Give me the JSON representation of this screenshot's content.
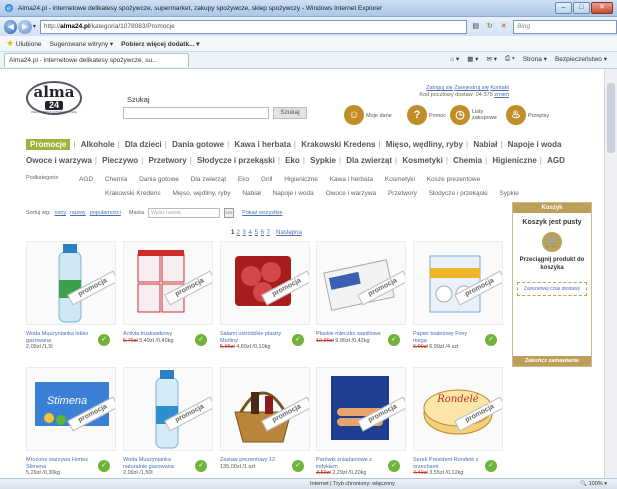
{
  "window": {
    "title": "Alma24.pl - internetowe delikatesy spożywcze, supermarket, zakupy spożywcze, sklep spożywczy - Windows Internet Explorer"
  },
  "addressbar": {
    "url_prefix": "http://",
    "url_domain": "alma24.pl",
    "url_path": "/kategoria/1078083/Promocje",
    "search_placeholder": "Bing"
  },
  "favorites": {
    "label": "Ulubione",
    "items": [
      "Sugerowane witryny ▾",
      "Pobierz więcej dodatk... ▾"
    ]
  },
  "tab": {
    "title": "Alma24.pl - internetowe delikatesy spożywcze, su...",
    "tools": [
      "Strona ▾",
      "Bezpieczeństwo ▾"
    ]
  },
  "header": {
    "logo_brand": "alma",
    "logo_number": "24",
    "logo_tagline": "DELIKATESY INTERNETOWE",
    "search_label": "Szukaj",
    "search_button": "Szukaj",
    "links_line1": [
      "Zaloguj się",
      "Zarejestruj się",
      "Kontakt"
    ],
    "postal_text": "Kod pocztowy dostaw: 04-375",
    "postal_link": "zmień",
    "icons": [
      {
        "label": "Moje dane",
        "icon": "user-icon"
      },
      {
        "label": "Pomoc",
        "icon": "help-icon"
      },
      {
        "label": "Listy zakupowe",
        "icon": "clock-icon"
      },
      {
        "label": "Przepisy",
        "icon": "pot-icon"
      }
    ]
  },
  "nav": {
    "row1": [
      "Promocje",
      "Alkohole",
      "Dla dzieci",
      "Dania gotowe",
      "Kawa i herbata",
      "Krakowski Kredens",
      "Mięso, wędliny, ryby",
      "Nabiał",
      "Napoje i woda"
    ],
    "row2": [
      "Owoce i warzywa",
      "Pieczywo",
      "Przetwory",
      "Słodycze i przekąski",
      "Eko",
      "Sypkie",
      "Dla zwierząt",
      "Kosmetyki",
      "Chemia",
      "Higieniczne",
      "AGD"
    ]
  },
  "subcategories": {
    "label": "Podkategorie",
    "row1": [
      "AGD",
      "Chemia",
      "Dania gotowe",
      "Dla zwierząt",
      "Eko",
      "Grill",
      "Higieniczne",
      "Kawa i herbata",
      "Kosmetyki",
      "Kosze prezentowe"
    ],
    "row2": [
      "Krakowski Kredens",
      "Mięso, wędliny, ryby",
      "Nabiał",
      "Napoje i woda",
      "Owoce i warzywa",
      "Przetwory",
      "Słodycze i przekąski",
      "Sypkie"
    ]
  },
  "sort": {
    "label": "Sortuj wg:",
    "by_price": "ceny",
    "by_name": "nazwy",
    "by_popularity": "popularności",
    "brand_label": "Marka",
    "brand_placeholder": "Wpisz nazwę",
    "go": "GO",
    "show_all": "Pokaż wszystkie"
  },
  "pagination": {
    "pages": [
      "1",
      "2",
      "3",
      "4",
      "5",
      "6",
      "7"
    ],
    "next": "Następna"
  },
  "products": [
    {
      "name": "Woda Muszynianka lekko gazowana",
      "old": "",
      "price": "2,09zł /1,5l",
      "promo": "promocja"
    },
    {
      "name": "Activia truskawkowy",
      "old": "5,79zł",
      "price": "5,49zł /0,40kg",
      "promo": "promocja"
    },
    {
      "name": "Salami ostródzkie plastry Morliny",
      "old": "5,99zł",
      "price": "4,69zł /0,10kg",
      "promo": "promocja"
    },
    {
      "name": "Płaskie mleczko waniliowe",
      "old": "12,99zł",
      "price": "9,99zł /0,42kg",
      "promo": "promocja"
    },
    {
      "name": "Papier toaletowy Foxy mega",
      "old": "6,99zł",
      "price": "6,99zł /4 szt",
      "promo": "promocja"
    },
    {
      "name": "Mrożone warzywa Hortex Stimena",
      "old": "",
      "price": "5,29zł /0,30kg",
      "promo": "promocja"
    },
    {
      "name": "Woda Muszynianka naturalnie gazowana",
      "old": "",
      "price": "2,09zł /1,50l",
      "promo": "promocja"
    },
    {
      "name": "Zestaw prezentowy 12",
      "old": "",
      "price": "135,00zł /1 szt",
      "promo": "promocja"
    },
    {
      "name": "Parówki śniadaniowe z indykiem",
      "old": "3,59zł",
      "price": "2,29zł /0,20kg",
      "promo": "promocja"
    },
    {
      "name": "Serek President Rondelé z orzechami",
      "old": "4,49zł",
      "price": "3,55zł /0,12kg",
      "promo": "promocja"
    }
  ],
  "cart": {
    "title": "Koszyk",
    "empty": "Koszyk jest pusty",
    "drag_hint": "Przeciągnij produkt do koszyka",
    "reserve": "Zarezerwuj czas dostawy",
    "finish": "Zakończ zamawianie"
  },
  "status": {
    "zone": "Internet | Tryb chroniony: włączony",
    "zoom": "100%"
  },
  "colors": {
    "promo_green": "#9bb43a",
    "cart_gold": "#bca05a",
    "link_blue": "#4a6fb1",
    "add_green": "#6fb33a"
  }
}
